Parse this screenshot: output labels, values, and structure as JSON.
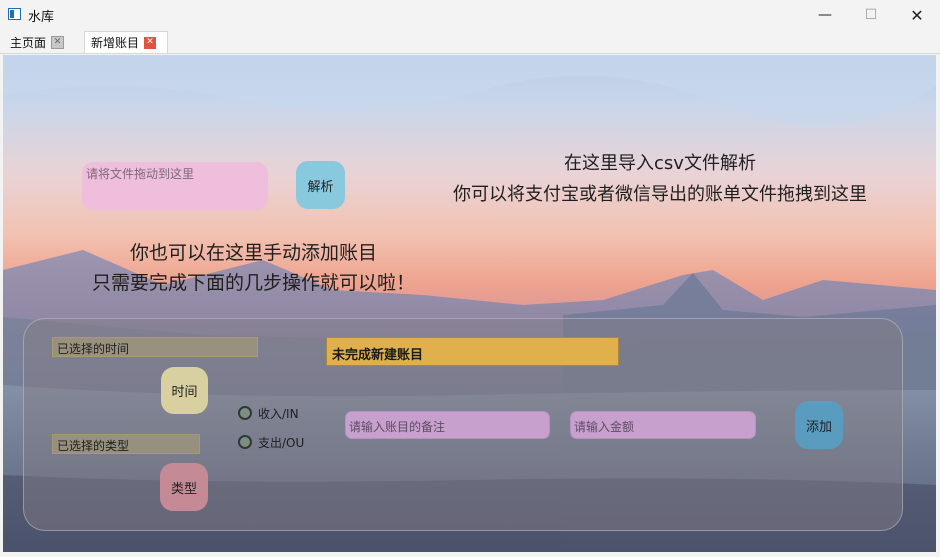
{
  "window": {
    "title": "水库",
    "controls": {
      "minimize": "—",
      "maximize": "☐",
      "close": "✕"
    }
  },
  "tabs": [
    {
      "label": "主页面",
      "close": "✕"
    },
    {
      "label": "新增账目",
      "close": "✕"
    }
  ],
  "import": {
    "hint_line1": "在这里导入csv文件解析",
    "hint_line2": "你可以将支付宝或者微信导出的账单文件拖拽到这里",
    "drop_placeholder": "请将文件拖动到这里",
    "parse_button": "解析"
  },
  "manual": {
    "line1": "你也可以在这里手动添加账目",
    "line2": "只需要完成下面的几步操作就可以啦！"
  },
  "form": {
    "time_label": "已选择的时间",
    "time_button": "时间",
    "type_label": "已选择的类型",
    "type_button": "类型",
    "status": "未完成新建账目",
    "radio_income": "收入/IN",
    "radio_expense": "支出/OU",
    "note_placeholder": "请输入账目的备注",
    "amount_placeholder": "请输入金额",
    "add_button": "添加"
  },
  "colors": {
    "parse_button": "#88c9dd",
    "status_box": "#e0b04d",
    "add_button": "#5a9cc0",
    "close_tab": "#e2533c"
  }
}
